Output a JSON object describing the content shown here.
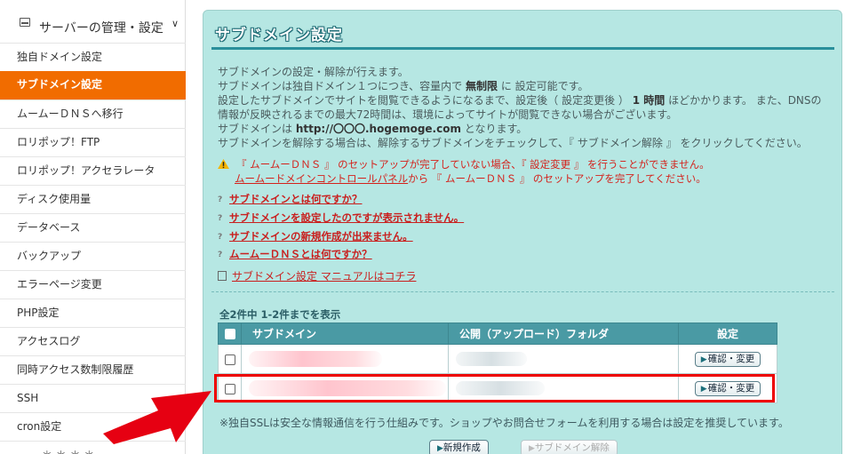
{
  "sidebar": {
    "section_label": "サーバーの管理・設定",
    "items": [
      {
        "label": "独自ドメイン設定"
      },
      {
        "label": "サブドメイン設定",
        "active": true
      },
      {
        "label": "ムームーＤＮＳへ移行"
      },
      {
        "label": "ロリポップ！FTP"
      },
      {
        "label": "ロリポップ！アクセラレータ"
      },
      {
        "label": "ディスク使用量"
      },
      {
        "label": "データベース"
      },
      {
        "label": "バックアップ"
      },
      {
        "label": "エラーページ変更"
      },
      {
        "label": "PHP設定"
      },
      {
        "label": "アクセスログ"
      },
      {
        "label": "同時アクセス数制限履歴"
      },
      {
        "label": "SSH"
      },
      {
        "label": "cron設定"
      },
      {
        "label": "…… ＊ ＊ ＊ ＊ ……"
      }
    ]
  },
  "main": {
    "title": "サブドメイン設定",
    "intro": {
      "line1": "サブドメインの設定・解除が行えます。",
      "line2_pre": "サブドメインは独自ドメイン１つにつき、容量内で ",
      "line2_bold": "無制限",
      "line2_post": " に 設定可能です。",
      "line3_pre": "設定したサブドメインでサイトを閲覧できるようになるまで、設定後（ 設定変更後 ） ",
      "line3_bold": "1 時間",
      "line3_post": " ほどかかります。 また、DNSの",
      "line4": "情報が反映されるまでの最大72時間は、環境によってサイトが閲覧できない場合がございます。",
      "line5_pre": "サブドメインは ",
      "line5_bold": "http://〇〇〇.hogemoge.com",
      "line5_post": " となります。",
      "line6": "サブドメインを解除する場合は、解除するサブドメインをチェックして、『 サブドメイン解除 』 をクリックしてください。"
    },
    "warning": {
      "line1": "『 ムームーＤＮＳ 』 のセットアップが完了していない場合、『 設定変更 』 を行うことができません。",
      "link": "ムームードメインコントロールパネル",
      "line2_post": "から 『 ムームーＤＮＳ 』 のセットアップを完了してください。"
    },
    "faq": [
      {
        "label": "サブドメインとは何ですか？"
      },
      {
        "label": "サブドメインを設定したのですが表示されません。"
      },
      {
        "label": "サブドメインの新規作成が出来ません。"
      },
      {
        "label": "ムームーＤＮＳとは何ですか？"
      }
    ],
    "manual_link": "サブドメイン設定 マニュアルはコチラ",
    "count_text": "全2件中 1-2件までを表示",
    "table": {
      "headers": [
        "サブドメイン",
        "公開（アップロード）フォルダ",
        "設定"
      ],
      "rows": [
        {
          "action": "確認・変更"
        },
        {
          "action": "確認・変更"
        }
      ]
    },
    "ssl_note": "※独自SSLは安全な情報通信を行う仕組みです。ショップやお問合せフォームを利用する場合は設定を推奨しています。",
    "buttons": {
      "create": "新規作成",
      "remove": "サブドメイン解除"
    }
  },
  "colors": {
    "accent": "#f16c00",
    "panel_bg": "#b6e7e3",
    "table_header": "#4a9aa4",
    "warning_text": "#d4221c",
    "highlight": "#ee0000"
  }
}
